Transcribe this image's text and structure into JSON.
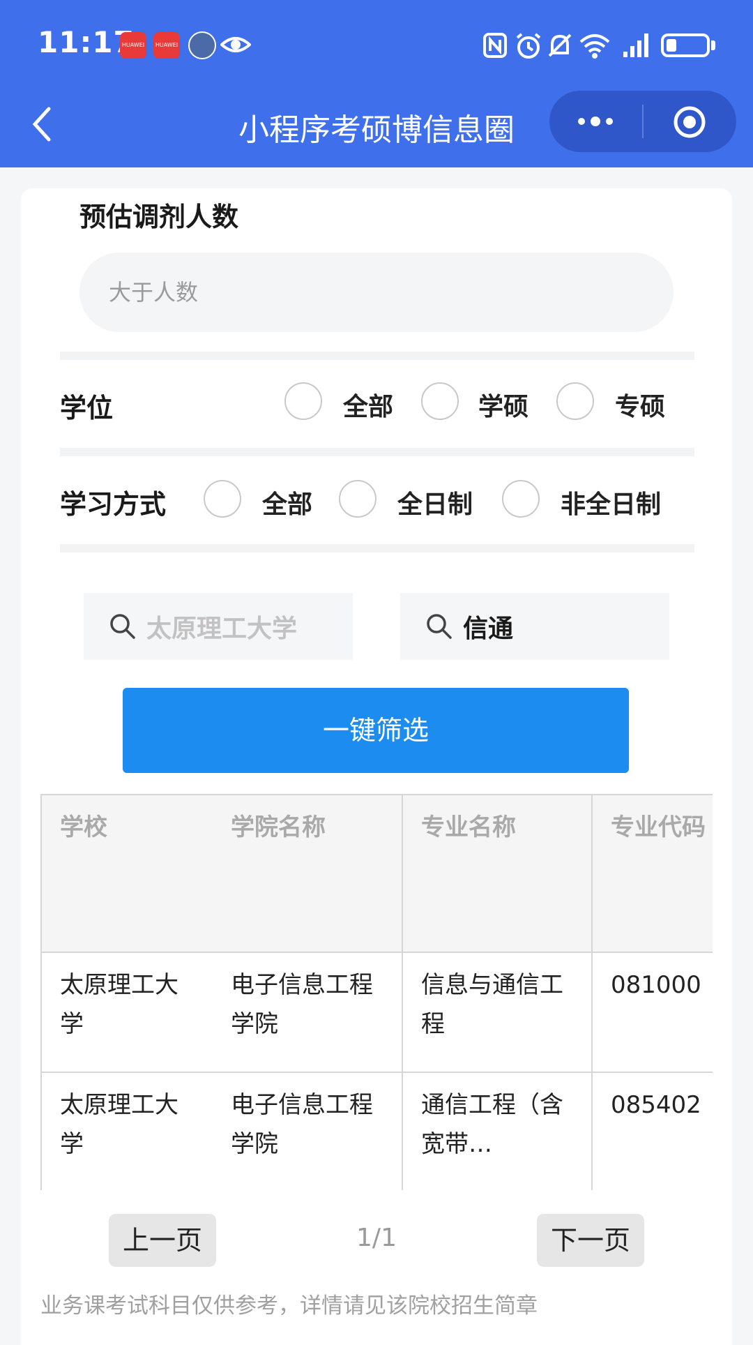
{
  "status_bar": {
    "time": "11:17",
    "app_badge": "HUAWEI"
  },
  "nav": {
    "title": "小程序考硕博信息圈"
  },
  "form": {
    "count_label": "预估调剂人数",
    "count_placeholder": "大于人数",
    "degree_label": "学位",
    "degree_options": [
      "全部",
      "学硕",
      "专硕"
    ],
    "study_label": "学习方式",
    "study_options": [
      "全部",
      "全日制",
      "非全日制"
    ],
    "school_search_placeholder": "太原理工大学",
    "major_search_value": "信通",
    "filter_button": "一键筛选"
  },
  "table": {
    "headers": [
      "学校",
      "学院名称",
      "专业名称",
      "专业代码"
    ],
    "rows": [
      [
        "太原理工大学",
        "电子信息工程学院",
        "信息与通信工程",
        "081000"
      ],
      [
        "太原理工大学",
        "电子信息工程学院",
        "通信工程（含宽带…",
        "085402"
      ]
    ]
  },
  "pager": {
    "prev": "上一页",
    "info": "1/1",
    "next": "下一页"
  },
  "footnote": "业务课考试科目仅供参考，详情请见该院校招生简章",
  "colors": {
    "header_bg": "#3f6fea",
    "primary_button": "#1c8cf0",
    "card_bg": "#ffffff",
    "page_bg": "#f5f6f8"
  }
}
